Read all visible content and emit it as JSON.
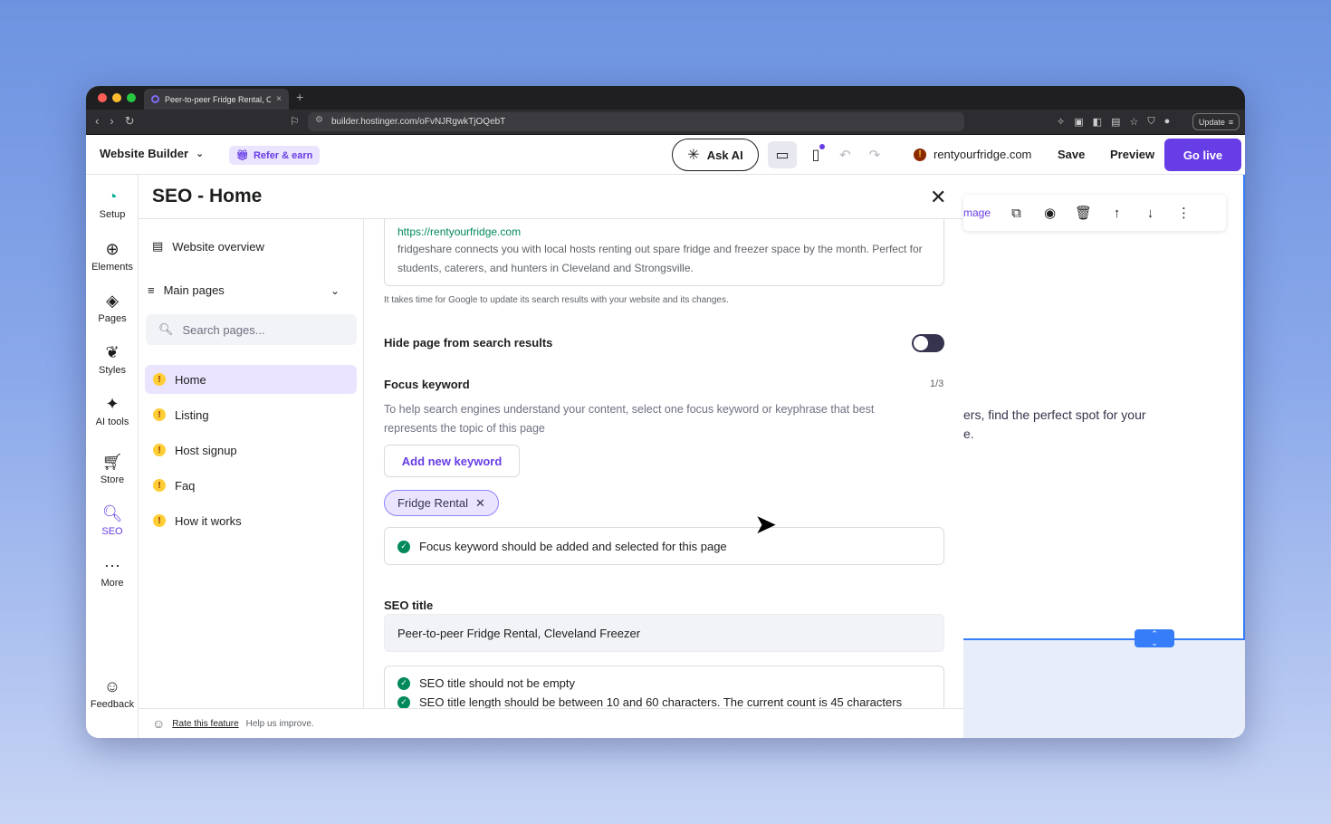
{
  "browser": {
    "tab_title": "Peer-to-peer Fridge Rental, Cl",
    "tab_close": "×",
    "new_tab": "+",
    "url": "builder.hostinger.com/oFvNJRgwkTjOQebT",
    "update_label": "Update"
  },
  "header": {
    "app_name": "Website Builder",
    "refer": "Refer & earn",
    "ask_ai": "Ask AI",
    "domain": "rentyourfridge.com",
    "save": "Save",
    "preview": "Preview",
    "go_live": "Go live"
  },
  "rail": [
    {
      "label": "Setup",
      "icon": "setup-icon"
    },
    {
      "label": "Elements",
      "icon": "plus-circle-icon"
    },
    {
      "label": "Pages",
      "icon": "layers-icon"
    },
    {
      "label": "Styles",
      "icon": "styles-icon"
    },
    {
      "label": "AI tools",
      "icon": "sparkle-icon"
    },
    {
      "label": "Store",
      "icon": "cart-icon"
    },
    {
      "label": "SEO",
      "icon": "seo-icon"
    },
    {
      "label": "More",
      "icon": "more-icon"
    },
    {
      "label": "Feedback",
      "icon": "feedback-icon"
    }
  ],
  "panel": {
    "title": "SEO - Home",
    "website_overview": "Website overview",
    "main_pages": "Main pages",
    "search_placeholder": "Search pages...",
    "pages": [
      "Home",
      "Listing",
      "Host signup",
      "Faq",
      "How it works"
    ],
    "preview_url": "https://rentyourfridge.com",
    "preview_desc": "fridgeshare connects you with local hosts renting out spare fridge and freezer space by the month. Perfect for students, caterers, and hunters in Cleveland and Strongsville.",
    "note": "It takes time for Google to update its search results with your website and its changes.",
    "hide_label": "Hide page from search results",
    "focus_keyword_label": "Focus keyword",
    "focus_keyword_count": "1/3",
    "focus_keyword_desc": "To help search engines understand your content, select one focus keyword or keyphrase that best represents the topic of this page",
    "add_keyword": "Add new keyword",
    "keyword_chip": "Fridge Rental",
    "keyword_check": "Focus keyword should be added and selected for this page",
    "seo_title_label": "SEO title",
    "seo_title_value": "Peer-to-peer Fridge Rental, Cleveland Freezer",
    "seo_checks": [
      "SEO title should not be empty",
      "SEO title length should be between 10 and 60 characters. The current count is 45 characters"
    ],
    "rate_link": "Rate this feature",
    "rate_suffix": "Help us improve."
  },
  "canvas": {
    "toolbar_text": "mage",
    "text_line1": "ers, find the perfect spot for your",
    "text_line2": "e."
  },
  "colors": {
    "accent": "#673de6",
    "success": "#00895a",
    "warning": "#ffcd35",
    "selection": "#357df9"
  }
}
